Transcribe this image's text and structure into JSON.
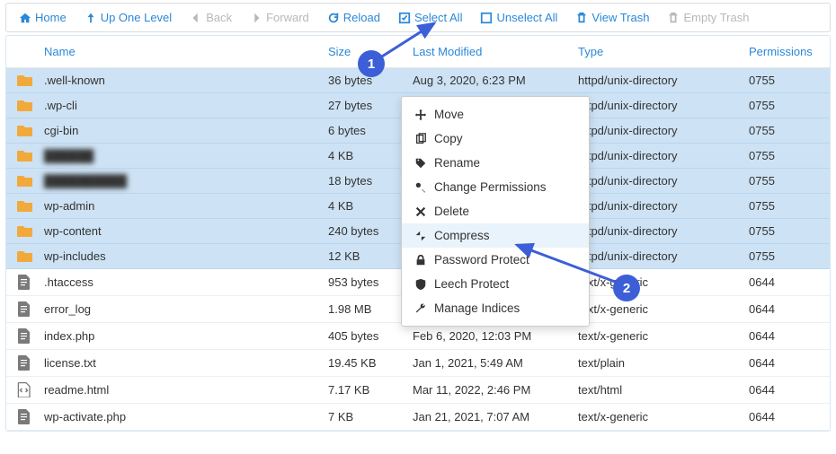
{
  "toolbar": {
    "home": "Home",
    "up": "Up One Level",
    "back": "Back",
    "forward": "Forward",
    "reload": "Reload",
    "selectAll": "Select All",
    "unselectAll": "Unselect All",
    "viewTrash": "View Trash",
    "emptyTrash": "Empty Trash"
  },
  "columns": {
    "name": "Name",
    "size": "Size",
    "lastModified": "Last Modified",
    "type": "Type",
    "permissions": "Permissions"
  },
  "rows": [
    {
      "icon": "folder",
      "name": ".well-known",
      "size": "36 bytes",
      "mod": "Aug 3, 2020, 6:23 PM",
      "type": "httpd/unix-directory",
      "perm": "0755",
      "selected": true
    },
    {
      "icon": "folder",
      "name": ".wp-cli",
      "size": "27 bytes",
      "mod": "",
      "type": "httpd/unix-directory",
      "perm": "0755",
      "selected": true
    },
    {
      "icon": "folder",
      "name": "cgi-bin",
      "size": "6 bytes",
      "mod": "",
      "type": "httpd/unix-directory",
      "perm": "0755",
      "selected": true
    },
    {
      "icon": "folder",
      "name": "██████",
      "blur": true,
      "size": "4 KB",
      "mod": "",
      "type": "httpd/unix-directory",
      "perm": "0755",
      "selected": true
    },
    {
      "icon": "folder",
      "name": "██████████",
      "blur": true,
      "size": "18 bytes",
      "mod": "",
      "type": "httpd/unix-directory",
      "perm": "0755",
      "selected": true
    },
    {
      "icon": "folder",
      "name": "wp-admin",
      "size": "4 KB",
      "mod": "",
      "type": "httpd/unix-directory",
      "perm": "0755",
      "selected": true
    },
    {
      "icon": "folder",
      "name": "wp-content",
      "size": "240 bytes",
      "mod": "",
      "type": "httpd/unix-directory",
      "perm": "0755",
      "selected": true
    },
    {
      "icon": "folder",
      "name": "wp-includes",
      "size": "12 KB",
      "mod": "",
      "type": "httpd/unix-directory",
      "perm": "0755",
      "selected": true
    },
    {
      "icon": "file",
      "name": ".htaccess",
      "size": "953 bytes",
      "mod": "",
      "type": "text/x-generic",
      "perm": "0644",
      "selected": false
    },
    {
      "icon": "file",
      "name": "error_log",
      "size": "1.98 MB",
      "mod": "Jan 28, 2022, 12:25 PM",
      "type": "text/x-generic",
      "perm": "0644",
      "selected": false
    },
    {
      "icon": "file",
      "name": "index.php",
      "size": "405 bytes",
      "mod": "Feb 6, 2020, 12:03 PM",
      "type": "text/x-generic",
      "perm": "0644",
      "selected": false
    },
    {
      "icon": "file",
      "name": "license.txt",
      "size": "19.45 KB",
      "mod": "Jan 1, 2021, 5:49 AM",
      "type": "text/plain",
      "perm": "0644",
      "selected": false
    },
    {
      "icon": "code",
      "name": "readme.html",
      "size": "7.17 KB",
      "mod": "Mar 11, 2022, 2:46 PM",
      "type": "text/html",
      "perm": "0644",
      "selected": false
    },
    {
      "icon": "file",
      "name": "wp-activate.php",
      "size": "7 KB",
      "mod": "Jan 21, 2021, 7:07 AM",
      "type": "text/x-generic",
      "perm": "0644",
      "selected": false
    }
  ],
  "context": {
    "move": "Move",
    "copy": "Copy",
    "rename": "Rename",
    "changePermissions": "Change Permissions",
    "delete": "Delete",
    "compress": "Compress",
    "passwordProtect": "Password Protect",
    "leechProtect": "Leech Protect",
    "manageIndices": "Manage Indices"
  },
  "annotations": {
    "badge1": "1",
    "badge2": "2"
  }
}
